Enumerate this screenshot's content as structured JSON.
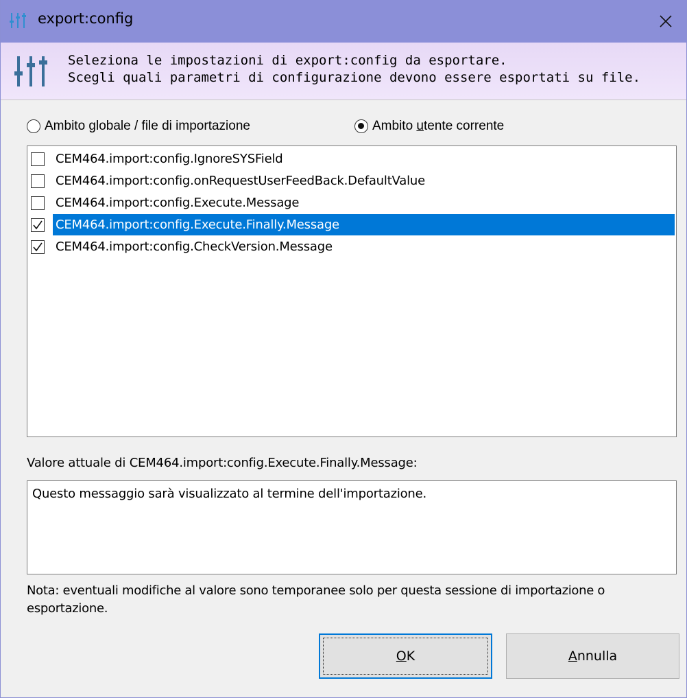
{
  "window": {
    "title": "export:config",
    "title_icon": "sliders-icon",
    "close_icon": "close-icon"
  },
  "header": {
    "line1": "Seleziona le impostazioni di export:config da esportare.",
    "line2": "Scegli quali parametri di configurazione devono essere esportati su file.",
    "icon": "sliders-icon"
  },
  "scope": {
    "global": {
      "pre": "Ambito ",
      "accel": "g",
      "post": "lobale / file di importazione",
      "selected": false
    },
    "user": {
      "pre": "Ambito ",
      "accel": "u",
      "post": "tente corrente",
      "selected": true
    }
  },
  "settings": [
    {
      "label": "CEM464.import:config.IgnoreSYSField",
      "checked": false,
      "selected": false
    },
    {
      "label": "CEM464.import:config.onRequestUserFeedBack.DefaultValue",
      "checked": false,
      "selected": false
    },
    {
      "label": "CEM464.import:config.Execute.Message",
      "checked": false,
      "selected": false
    },
    {
      "label": "CEM464.import:config.Execute.Finally.Message",
      "checked": true,
      "selected": true
    },
    {
      "label": "CEM464.import:config.CheckVersion.Message",
      "checked": true,
      "selected": false
    }
  ],
  "value": {
    "label": "Valore attuale di CEM464.import:config.Execute.Finally.Message:",
    "text": "Questo messaggio sarà visualizzato al termine dell'importazione."
  },
  "note": "Nota: eventuali modifiche al valore sono temporanee solo per questa sessione di importazione o esportazione.",
  "buttons": {
    "ok_accel": "O",
    "ok_rest": "K",
    "cancel_accel": "A",
    "cancel_rest": "nnulla"
  },
  "colors": {
    "title_bar": "#8b8fd8",
    "selection": "#0078d7",
    "header_band": "#ebdff8"
  }
}
